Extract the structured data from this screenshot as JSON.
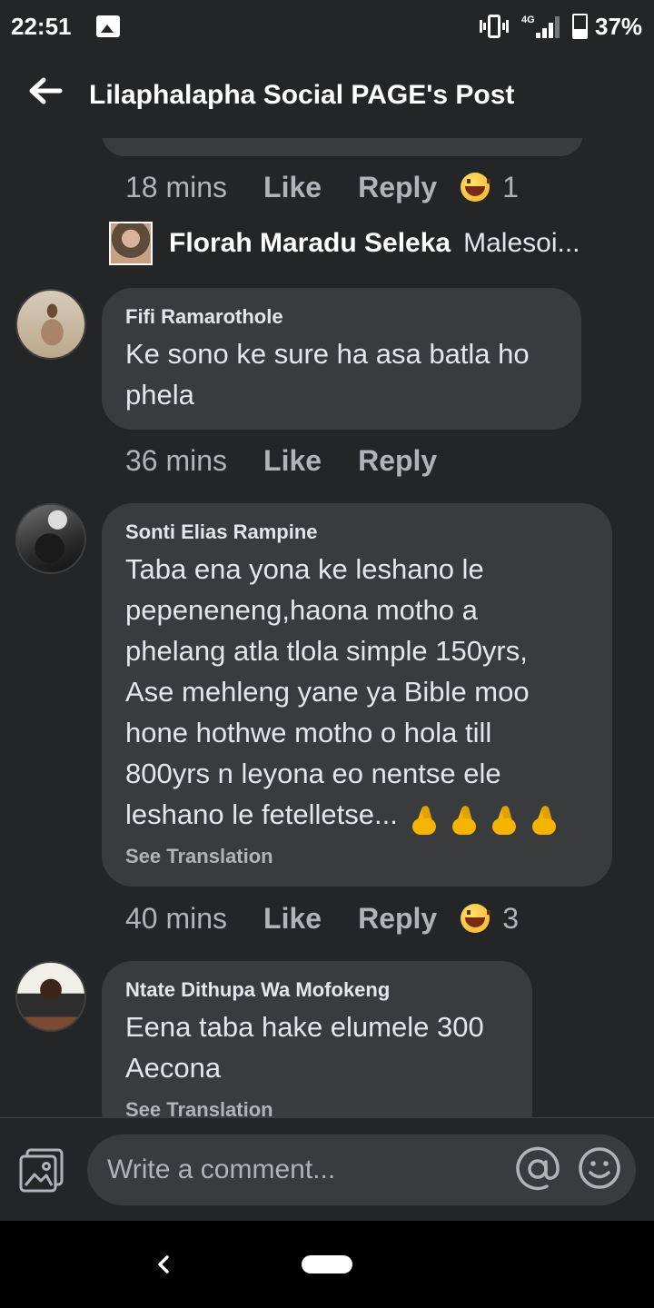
{
  "status_bar": {
    "time": "22:51",
    "network": "4G",
    "battery": "37%",
    "battery_level": 0.37
  },
  "header": {
    "title": "Lilaphalapha Social PAGE's Post"
  },
  "feed": {
    "previous_comment": {
      "time": "18 mins",
      "like": "Like",
      "reply": "Reply",
      "reaction_count": "1",
      "reply_preview": {
        "author": "Florah Maradu Seleka",
        "text": "Malesoi..."
      }
    },
    "comments": [
      {
        "author": "Fifi Ramarothole",
        "text": "Ke sono ke sure ha asa batla ho\nphela",
        "time": "36 mins",
        "like": "Like",
        "reply": "Reply"
      },
      {
        "author": "Sonti Elias Rampine",
        "text": "Taba ena yona ke leshano le\npepeneneng,haona motho a\nphelang atla tlola simple 150yrs,\nAse mehleng yane ya Bible moo\nhone hothwe motho o hola till\n800yrs n leyona eo nentse ele\nleshano le fetelletse...",
        "emoji_count": 4,
        "see_translation": "See Translation",
        "time": "40 mins",
        "like": "Like",
        "reply": "Reply",
        "reaction_count": "3"
      },
      {
        "author": "Ntate Dithupa Wa Mofokeng",
        "text": "Eena taba hake elumele 300\nAecona",
        "see_translation": "See Translation"
      }
    ]
  },
  "composer": {
    "placeholder": "Write a comment..."
  },
  "icons": {
    "back": "arrow-left-icon",
    "photo": "photo-icon",
    "mention": "at-sign-icon",
    "emoji": "smiley-icon",
    "reaction": "laughing-emoji-icon",
    "crossed_fingers": "crossed-fingers-emoji"
  }
}
